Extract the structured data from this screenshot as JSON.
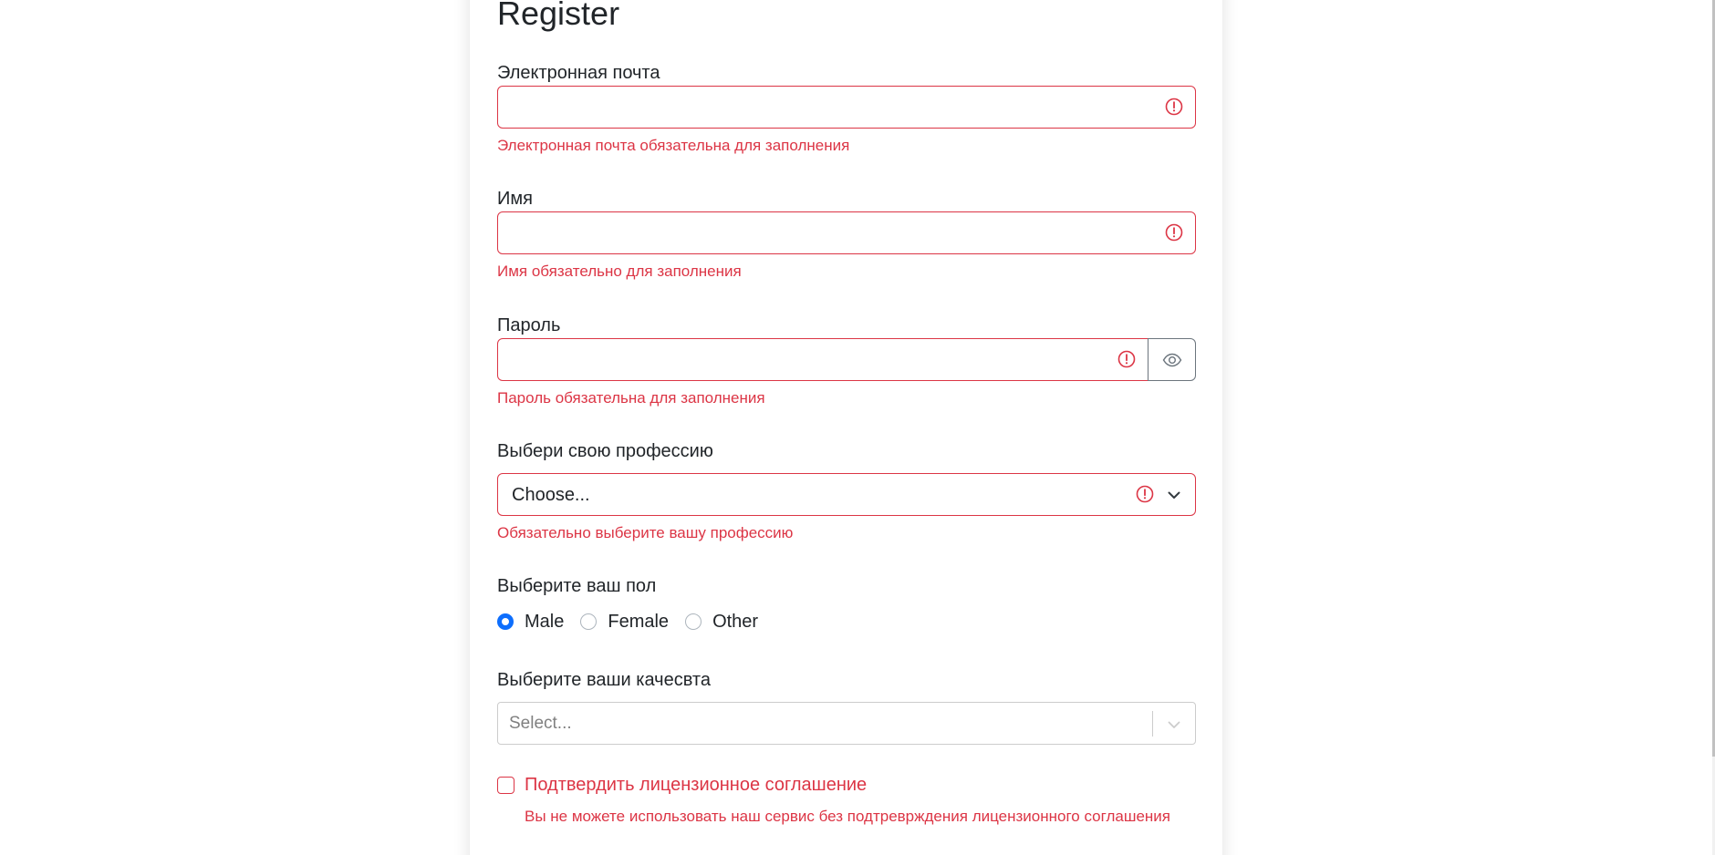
{
  "form": {
    "title": "Register",
    "email": {
      "label": "Электронная почта",
      "value": "",
      "error": "Электронная почта обязательна для заполнения"
    },
    "name": {
      "label": "Имя",
      "value": "",
      "error": "Имя обязательно для заполнения"
    },
    "password": {
      "label": "Пароль",
      "value": "",
      "error": "Пароль обязательна для заполнения",
      "toggle_icon": "eye-icon"
    },
    "profession": {
      "label": "Выбери свою профессию",
      "selected": "Choose...",
      "error": "Обязательно выберите вашу профессию"
    },
    "gender": {
      "label": "Выберите ваш пол",
      "options": [
        "Male",
        "Female",
        "Other"
      ],
      "selected": "Male"
    },
    "qualities": {
      "label": "Выберите ваши качесвта",
      "placeholder": "Select..."
    },
    "license": {
      "label": "Подтвердить лицензионное соглашение",
      "checked": false,
      "error": "Вы не можете использовать наш сервис без подтреврждения лицензионного соглашения"
    }
  },
  "colors": {
    "error": "#dc3545",
    "accent": "#0d6efd",
    "text": "#212529",
    "muted_border": "#cccccc"
  }
}
